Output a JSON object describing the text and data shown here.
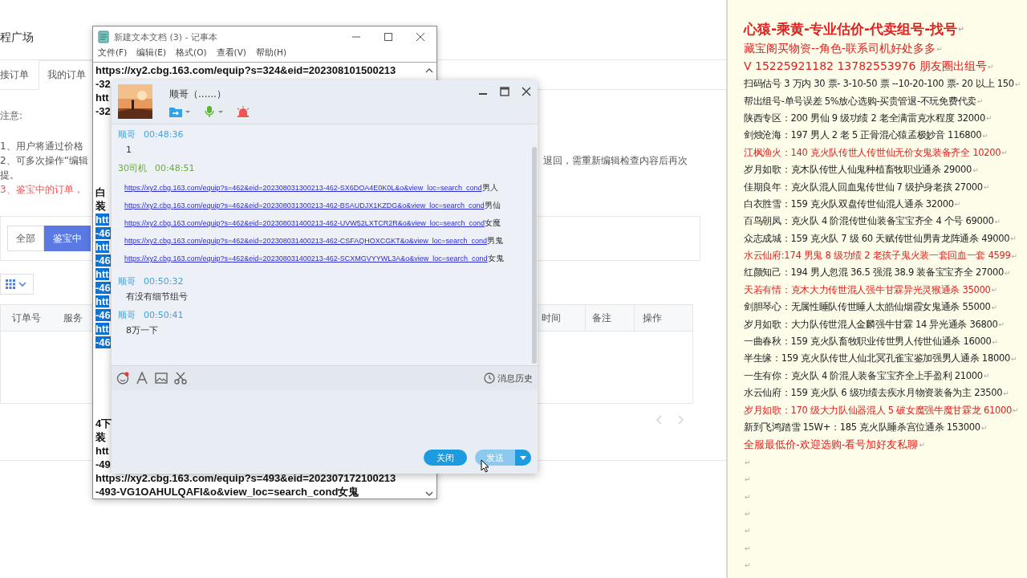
{
  "page": {
    "title": "程广场",
    "tabs": [
      {
        "label": "接订单",
        "selected": false
      },
      {
        "label": "我的订单",
        "selected": true
      }
    ],
    "notice_label": "注意:",
    "notes": [
      {
        "text": "1、用户将通过价格",
        "kind": "normal"
      },
      {
        "text": "2、可多次操作“编辑",
        "tail": "退回，需重新编辑检查内容后再次",
        "kind": "normal"
      },
      {
        "text": "提。",
        "kind": "normal"
      },
      {
        "text": "3、鉴宝中的订单，",
        "kind": "warning"
      }
    ],
    "filters": [
      {
        "label": "全部",
        "selected": false
      },
      {
        "label": "鉴宝中",
        "selected": true
      }
    ],
    "table": {
      "columns_left": [
        "订单号",
        "服务"
      ],
      "columns_right": [
        "时间",
        "备注",
        "操作"
      ]
    }
  },
  "notepad": {
    "title": "新建文本文档 (3) - 记事本",
    "menu": [
      "文件(F)",
      "编辑(E)",
      "格式(O)",
      "查看(V)",
      "帮助(H)"
    ],
    "blocks": [
      [
        {
          "text": "https://xy2.cbg.163.com/equip?s=324&eid=202308101500213",
          "selected": false
        },
        {
          "text": "-32",
          "selected": false
        },
        {
          "text": "htt",
          "selected": false
        },
        {
          "text": "-32",
          "selected": false
        }
      ],
      [
        {
          "text": "白",
          "selected": false
        },
        {
          "text": "装",
          "selected": false
        },
        {
          "text": "htt",
          "selected": true
        },
        {
          "text": "-46",
          "selected": true
        },
        {
          "text": "htt",
          "selected": true
        },
        {
          "text": "-46",
          "selected": true
        },
        {
          "text": "htt",
          "selected": true
        },
        {
          "text": "-46",
          "selected": true
        },
        {
          "text": "htt",
          "selected": true
        },
        {
          "text": "-46",
          "selected": true
        },
        {
          "text": "htt",
          "selected": true
        },
        {
          "text": "-46",
          "selected": true
        }
      ],
      [
        {
          "text": "4下",
          "selected": false
        },
        {
          "text": "装",
          "selected": false
        },
        {
          "text": "htt",
          "selected": false
        },
        {
          "text": "-49",
          "selected": false
        },
        {
          "text": "https://xy2.cbg.163.com/equip?s=493&eid=202307172100213",
          "selected": false
        },
        {
          "text": "-493-VG1OAHULQAFI&o&view_loc=search_cond女鬼",
          "selected": false
        }
      ]
    ]
  },
  "chat": {
    "contact": "顺哥（......）",
    "messages": [
      {
        "sender": "顺哥",
        "time": "00:48:36",
        "color": "#3ea3d8",
        "kind": "text",
        "text": "1"
      },
      {
        "sender": "30司机",
        "time": "00:48:51",
        "color": "#6aab3c",
        "kind": "links",
        "links": [
          {
            "url": "https://xy2.cbg.163.com/equip?s=462&eid=202308031300213-462-SX6DOA4E0K0L&o&view_loc=search_cond",
            "suffix": "男人"
          },
          {
            "url": "https://xy2.cbg.163.com/equip?s=462&eid=202308031300213-462-BSAUDJX1KZDG&o&view_loc=search_cond",
            "suffix": "男仙"
          },
          {
            "url": "https://xy2.cbg.163.com/equip?s=462&eid=202308031400213-462-UVW52LXTCR2R&o&view_loc=search_cond",
            "suffix": "女魔"
          },
          {
            "url": "https://xy2.cbg.163.com/equip?s=462&eid=202308031400213-462-CSFAQHOXCGKT&o&view_loc=search_cond",
            "suffix": "男鬼"
          },
          {
            "url": "https://xy2.cbg.163.com/equip?s=462&eid=202308031400213-462-SCXMGVYYWL3A&o&view_loc=search_cond",
            "suffix": "女鬼"
          }
        ]
      },
      {
        "sender": "顺哥",
        "time": "00:50:32",
        "color": "#3ea3d8",
        "kind": "text",
        "text": "有没有细节组号"
      },
      {
        "sender": "顺哥",
        "time": "00:50:41",
        "color": "#3ea3d8",
        "kind": "text",
        "text": "8万一下"
      }
    ],
    "history_label": "消息历史",
    "close_label": "关闭",
    "send_label": "发送"
  },
  "ad_panel": {
    "lines": [
      {
        "kind": "heading",
        "color": "#e02020",
        "text": "心猿-乘黄-专业估价-代卖组号-找号",
        "mark": "↵"
      },
      {
        "kind": "large",
        "color": "#e02020",
        "text": "藏宝阁买物资--角色-联系司机好处多多",
        "mark": "↵"
      },
      {
        "kind": "large",
        "color": "#e02020",
        "text": "V 15225921182   13782553976 朋友圈出组号",
        "mark": "↵"
      },
      {
        "kind": "normal",
        "color": "#222222",
        "text": "扫码估号 3 万内 30 票- 3-10-50 票  --10-20-100 票- 20 以上 150",
        "mark": "↵"
      },
      {
        "kind": "normal",
        "color": "#222222",
        "text": "帮出组号-单号误差 5%放心选购-买贵管退-不玩免费代卖",
        "mark": "↵"
      },
      {
        "kind": "normal",
        "color": "#222222",
        "text": "陕西专区：200 男仙 9 级功绩 2 老全满雷克水程度 32000",
        "mark": "↵"
      },
      {
        "kind": "normal",
        "color": "#222222",
        "text": "剑烛沧海：197 男人 2 老 5 正骨混心猿孟极妙音 116800",
        "mark": "↵"
      },
      {
        "kind": "normal",
        "color": "#e02020",
        "text": "江枫渔火：140 克火队传世人传世仙无价女鬼装备齐全 10200",
        "mark": "↵"
      },
      {
        "kind": "normal",
        "color": "#222222",
        "text": "岁月如歌：克木队传世人仙鬼种植畜牧职业通杀 29000",
        "mark": "↵"
      },
      {
        "kind": "normal",
        "color": "#222222",
        "text": "佳期良年：克火队混人回血鬼传世仙 7 级护身老孩 27000",
        "mark": "↵"
      },
      {
        "kind": "normal",
        "color": "#222222",
        "text": "白衣胜雪：159 克火队双盘传世仙混人通杀 32000",
        "mark": "↵"
      },
      {
        "kind": "normal",
        "color": "#222222",
        "text": "百鸟朝凤：克火队 4 阶混传世仙装备宝宝齐全 4 个号 69000",
        "mark": "↵"
      },
      {
        "kind": "normal",
        "color": "#222222",
        "text": "众志成城：159 克火队 7 级 60 天赋传世仙男青龙阵通杀 49000",
        "mark": "↵"
      },
      {
        "kind": "normal",
        "color": "#e02020",
        "text": "水云仙府:174 男鬼 8 级功绩 2 老孩子鬼火装一套回血一套 4599",
        "mark": "↵"
      },
      {
        "kind": "normal",
        "color": "#222222",
        "text": "红颜知己：194 男人忽混 36.5 强混 38.9 装备宝宝齐全 27000",
        "mark": "↵"
      },
      {
        "kind": "normal",
        "color": "#e02020",
        "text": "天若有情：克木大力传世混人强牛甘霖异光灵猴通杀 35000",
        "mark": "↵"
      },
      {
        "kind": "normal",
        "color": "#222222",
        "text": "剑胆琴心：无属性睡队传世睡人太皓仙烟霞女鬼通杀 55000",
        "mark": "↵"
      },
      {
        "kind": "normal",
        "color": "#222222",
        "text": "岁月如歌：大力队传世混人金麟强牛甘霖 14 异光通杀 36800",
        "mark": "↵"
      },
      {
        "kind": "normal",
        "color": "#222222",
        "text": "一曲春秋：159 克火队畜牧职业传世男人传世仙通杀 16000",
        "mark": "↵"
      },
      {
        "kind": "normal",
        "color": "#222222",
        "text": "半生缘：159 克火队传世人仙北冥孔雀宝鉴加强男人通杀 18000",
        "mark": "↵"
      },
      {
        "kind": "normal",
        "color": "#222222",
        "text": "一生有你：克火队 4 阶混人装备宝宝齐全上手盈利 21000",
        "mark": "↵"
      },
      {
        "kind": "normal",
        "color": "#222222",
        "text": "水云仙府：159 克火队 6 级功绩去疾水月物资装备为主 23500",
        "mark": "↵"
      },
      {
        "kind": "normal",
        "color": "#e02020",
        "text": "岁月如歌：170 级大力队仙器混人 5 破女魔强牛魔甘霖龙 61000",
        "mark": "↵"
      },
      {
        "kind": "normal",
        "color": "#222222",
        "text": "新到飞鸿踏雪 15W+：185 克火队睡杀宫位通杀 153000",
        "mark": "↵"
      },
      {
        "kind": "medium",
        "color": "#e02020",
        "text": "全服最低价-欢迎选购-看号加好友私聊",
        "mark": "↵"
      },
      {
        "kind": "normal",
        "mark": "↵"
      },
      {
        "kind": "normal",
        "mark": "↵"
      },
      {
        "kind": "normal",
        "mark": "↵"
      },
      {
        "kind": "normal",
        "mark": "↵"
      },
      {
        "kind": "normal",
        "mark": "↵"
      },
      {
        "kind": "normal",
        "mark": "↵"
      },
      {
        "kind": "normal",
        "mark": "↵"
      }
    ]
  }
}
